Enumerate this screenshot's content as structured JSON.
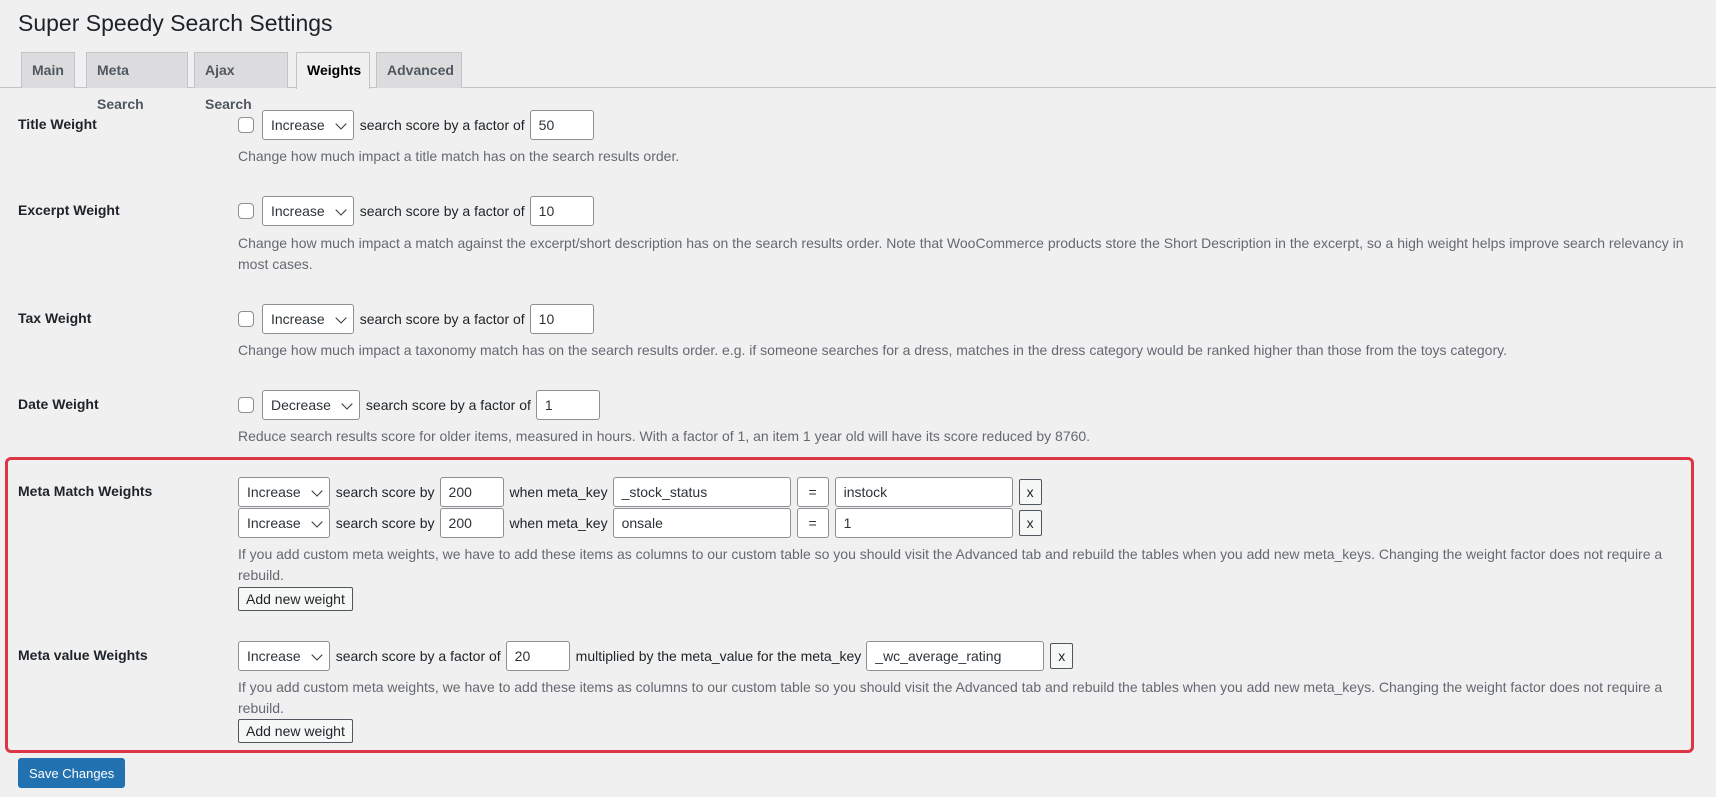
{
  "title": "Super Speedy Search Settings",
  "tabs": [
    {
      "label": "Main"
    },
    {
      "label": "Meta Search"
    },
    {
      "label": "Ajax Search"
    },
    {
      "label": "Weights"
    },
    {
      "label": "Advanced"
    }
  ],
  "active_tab": "Weights",
  "factor_text": "search score by a factor of",
  "weights": {
    "title": {
      "label": "Title Weight",
      "direction": "Increase",
      "factor": "50",
      "checked": false,
      "description": "Change how much impact a title match has on the search results order."
    },
    "excerpt": {
      "label": "Excerpt Weight",
      "direction": "Increase",
      "factor": "10",
      "checked": false,
      "description": "Change how much impact a match against the excerpt/short description has on the search results order. Note that WooCommerce products store the Short Description in the excerpt, so a high weight helps improve search relevancy in most cases."
    },
    "tax": {
      "label": "Tax Weight",
      "direction": "Increase",
      "factor": "10",
      "checked": false,
      "description": "Change how much impact a taxonomy match has on the search results order. e.g. if someone searches for a dress, matches in the dress category would be ranked higher than those from the toys category."
    },
    "date": {
      "label": "Date Weight",
      "direction": "Decrease",
      "factor": "1",
      "checked": false,
      "description": "Reduce search results score for older items, measured in hours. With a factor of 1, an item 1 year old will have its score reduced by 8760."
    }
  },
  "meta_match": {
    "label": "Meta Match Weights",
    "score_by_text": "search score by",
    "when_text": "when meta_key",
    "rows": [
      {
        "direction": "Increase",
        "score": "200",
        "meta_key": "_stock_status",
        "operator": "=",
        "value": "instock",
        "remove": "x"
      },
      {
        "direction": "Increase",
        "score": "200",
        "meta_key": "onsale",
        "operator": "=",
        "value": "1",
        "remove": "x"
      }
    ],
    "description": "If you add custom meta weights, we have to add these items as columns to our custom table so you should visit the Advanced tab and rebuild the tables when you add new meta_keys. Changing the weight factor does not require a rebuild.",
    "add_label": "Add new weight"
  },
  "meta_value": {
    "label": "Meta value Weights",
    "direction": "Increase",
    "factor_text": "search score by a factor of",
    "factor": "20",
    "multiplied_text": "multiplied by the meta_value for the meta_key",
    "meta_key": "_wc_average_rating",
    "remove": "x",
    "description": "If you add custom meta weights, we have to add these items as columns to our custom table so you should visit the Advanced tab and rebuild the tables when you add new meta_keys. Changing the weight factor does not require a rebuild.",
    "add_label": "Add new weight"
  },
  "save_label": "Save Changes",
  "colors": {
    "primary": "#2271b1",
    "highlight": "#dc3545"
  }
}
